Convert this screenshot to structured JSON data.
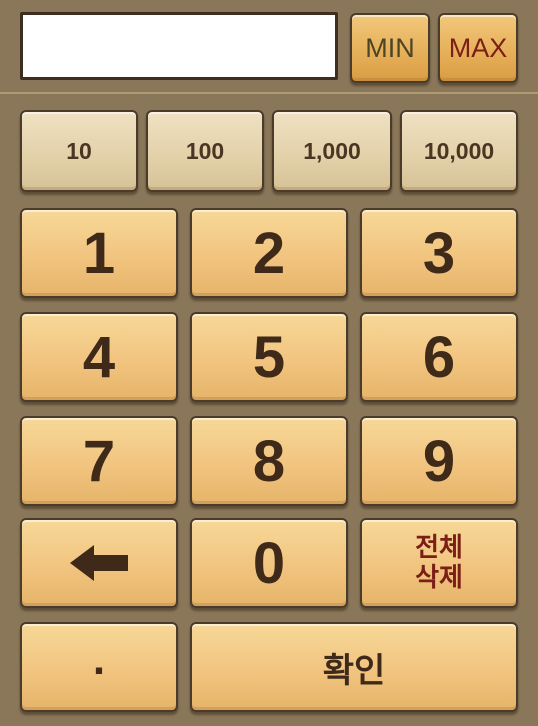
{
  "display": {
    "value": "",
    "placeholder": ""
  },
  "top": {
    "min_label": "MIN",
    "max_label": "MAX"
  },
  "quick_amounts": [
    "10",
    "100",
    "1,000",
    "10,000"
  ],
  "keys": {
    "k1": "1",
    "k2": "2",
    "k3": "3",
    "k4": "4",
    "k5": "5",
    "k6": "6",
    "k7": "7",
    "k8": "8",
    "k9": "9",
    "k0": "0",
    "clear_line1": "전체",
    "clear_line2": "삭제",
    "dot": ".",
    "confirm": "확인"
  },
  "icons": {
    "backspace": "left-arrow-icon"
  },
  "colors": {
    "background": "#8a7759",
    "key_orange": "#f1c47f",
    "key_beige": "#e2d0a8",
    "max_red": "#7a1e16",
    "min_olive": "#4b4526",
    "text_brown": "#3f2a1a"
  }
}
